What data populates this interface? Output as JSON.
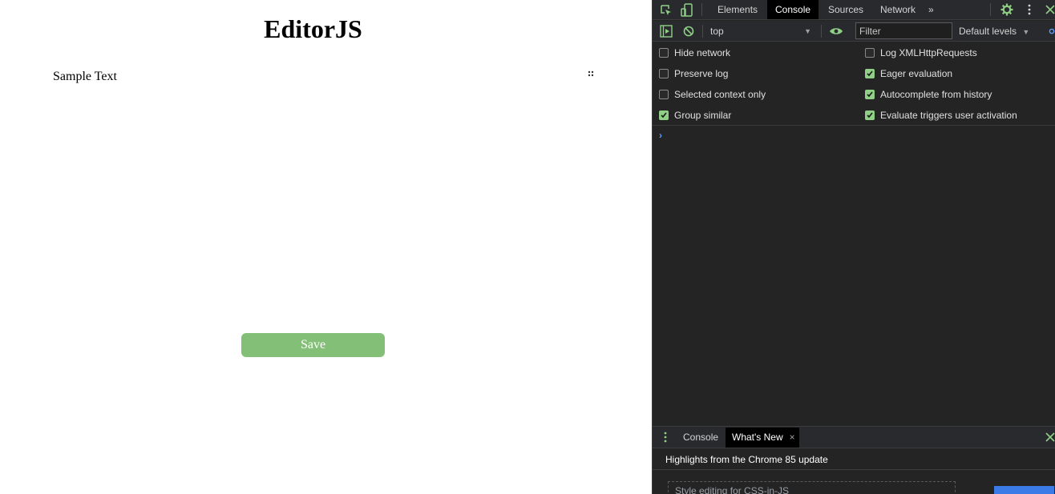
{
  "page": {
    "title": "EditorJS",
    "block_text": "Sample Text",
    "save_label": "Save"
  },
  "devtools": {
    "tabs": [
      {
        "label": "Elements",
        "active": false
      },
      {
        "label": "Console",
        "active": true
      },
      {
        "label": "Sources",
        "active": false
      },
      {
        "label": "Network",
        "active": false
      }
    ],
    "more_tabs": "»",
    "toolbar": {
      "context": "top",
      "filter_placeholder": "Filter",
      "levels": "Default levels"
    },
    "settings": {
      "hide_network": {
        "label": "Hide network",
        "checked": false
      },
      "log_xhr": {
        "label": "Log XMLHttpRequests",
        "checked": false
      },
      "preserve_log": {
        "label": "Preserve log",
        "checked": false
      },
      "eager_eval": {
        "label": "Eager evaluation",
        "checked": true
      },
      "selected_context": {
        "label": "Selected context only",
        "checked": false
      },
      "autocomplete": {
        "label": "Autocomplete from history",
        "checked": true
      },
      "group_similar": {
        "label": "Group similar",
        "checked": true
      },
      "eval_triggers": {
        "label": "Evaluate triggers user activation",
        "checked": true
      }
    },
    "prompt": "›",
    "drawer": {
      "tabs": [
        {
          "label": "Console",
          "active": false
        },
        {
          "label": "What's New",
          "active": true
        }
      ],
      "close_tab": "×",
      "heading": "Highlights from the Chrome 85 update",
      "card_text": "Style editing for CSS-in-JS"
    },
    "colors": {
      "accent_green": "#8fcf86",
      "save_button": "#84bf78",
      "prompt_blue": "#5aa0ff"
    }
  }
}
